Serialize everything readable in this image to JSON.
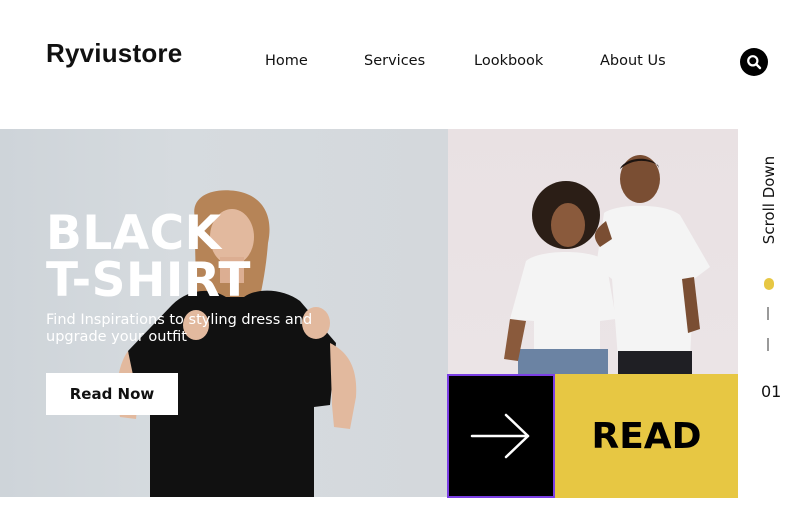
{
  "brand": {
    "name": "Ryviustore"
  },
  "nav": {
    "items": [
      "Home",
      "Services",
      "Lookbook",
      "About Us"
    ]
  },
  "search": {
    "icon": "search-icon"
  },
  "hero": {
    "title_line1": "BLACK",
    "title_line2": "T-SHIRT",
    "subtitle": "Find Inspirations to styling dress and upgrade your outfit",
    "cta_label": "Read Now"
  },
  "feature": {
    "arrow_icon": "arrow-right-icon",
    "read_label": "READ"
  },
  "side": {
    "scroll_label": "Scroll Down",
    "page_number": "01"
  },
  "colors": {
    "accent_yellow": "#e7c743",
    "accent_purple": "#7b3fe4",
    "dark": "#000000",
    "white": "#ffffff"
  }
}
